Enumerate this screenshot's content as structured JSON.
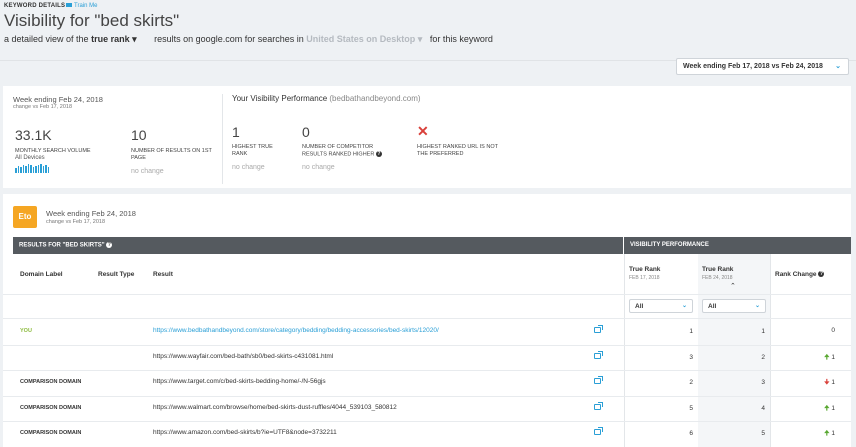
{
  "header": {
    "section_label": "KEYWORD DETAILS",
    "train_link": "Train Me",
    "title": "Visibility for \"bed skirts\"",
    "subtitle_pre": "a detailed view of the",
    "rank_mode": "true rank",
    "subtitle_mid": "results on google.com for searches in",
    "location": "United States on Desktop",
    "subtitle_post": "for this keyword"
  },
  "date_selector": {
    "value": "Week ending Feb 17, 2018 vs Feb 24, 2018"
  },
  "summary": {
    "week": "Week ending Feb 24, 2018",
    "change": "change vs Feb 17, 2018",
    "volume": {
      "value": "33.1K",
      "label": "MONTHLY SEARCH VOLUME",
      "devices": "All Devices"
    },
    "results_first_page": {
      "value": "10",
      "label": "NUMBER OF RESULTS ON 1ST PAGE",
      "change": "no change"
    },
    "your_title": "Your Visibility Performance",
    "your_domain": "(bedbathandbeyond.com)",
    "highest_rank": {
      "value": "1",
      "label": "HIGHEST TRUE RANK",
      "change": "no change"
    },
    "competitors_higher": {
      "value": "0",
      "label": "NUMBER OF COMPETITOR RESULTS RANKED HIGHER",
      "change": "no change"
    },
    "preferred": {
      "label": "HIGHEST RANKED URL IS NOT THE PREFERRED"
    }
  },
  "results": {
    "badge": "Eto",
    "week": "Week ending Feb 24, 2018",
    "change": "change vs Feb 17, 2018",
    "bar_left": "RESULTS FOR \"bed skirts\"",
    "bar_right": "VISIBILITY PERFORMANCE",
    "columns": {
      "domain_label": "Domain Label",
      "result_type": "Result Type",
      "result": "Result",
      "rank1": "True Rank",
      "rank1_date": "FEB 17, 2018",
      "rank2": "True Rank",
      "rank2_date": "FEB 24, 2018",
      "rank_change": "Rank Change"
    },
    "filter1": "All",
    "filter2": "All",
    "rows": [
      {
        "label": "YOU",
        "url": "https://www.bedbathandbeyond.com/store/category/bedding/bedding-accessories/bed-skirts/12020/",
        "rank1": "1",
        "rank2": "1",
        "change": "0",
        "dir": "none"
      },
      {
        "label": "",
        "url": "https://www.wayfair.com/bed-bath/sb0/bed-skirts-c431081.html",
        "rank1": "3",
        "rank2": "2",
        "change": "1",
        "dir": "up"
      },
      {
        "label": "COMPARISON DOMAIN",
        "url": "https://www.target.com/c/bed-skirts-bedding-home/-/N-56gjs",
        "rank1": "2",
        "rank2": "3",
        "change": "1",
        "dir": "down"
      },
      {
        "label": "COMPARISON DOMAIN",
        "url": "https://www.walmart.com/browse/home/bed-skirts-dust-ruffles/4044_539103_580812",
        "rank1": "5",
        "rank2": "4",
        "change": "1",
        "dir": "up"
      },
      {
        "label": "COMPARISON DOMAIN",
        "url": "https://www.amazon.com/bed-skirts/b?ie=UTF8&node=3732211",
        "rank1": "6",
        "rank2": "5",
        "change": "1",
        "dir": "up"
      }
    ]
  },
  "colors": {
    "accent": "#2a9fd6",
    "you": "#8dbb3f",
    "up": "#5aa832",
    "down": "#d9403a",
    "badge": "#f5a623"
  }
}
